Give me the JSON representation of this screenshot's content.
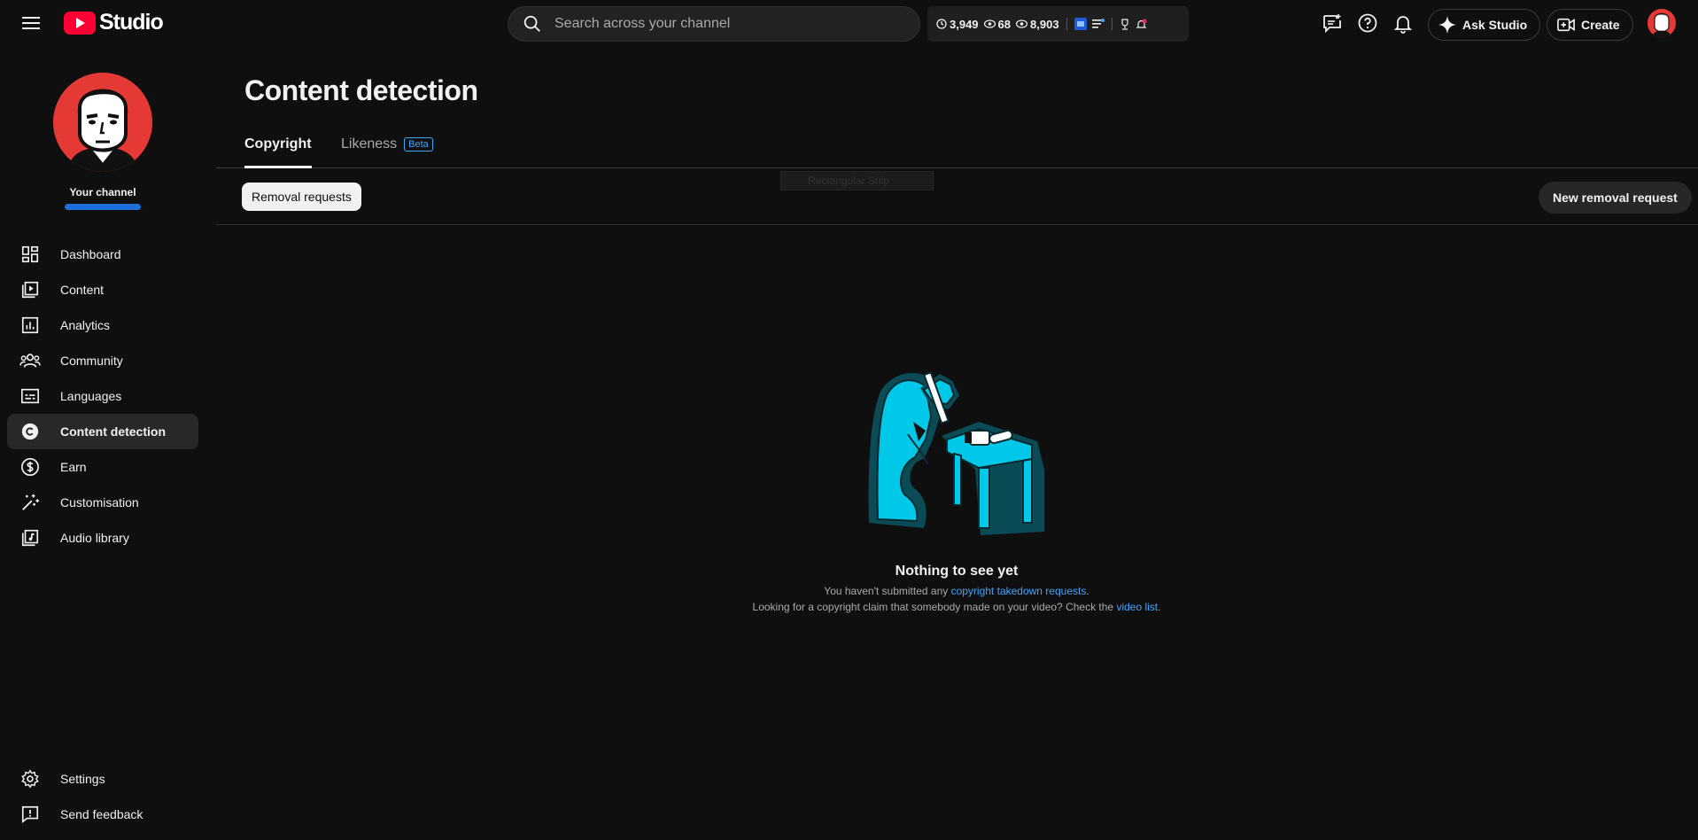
{
  "topbar": {
    "logo_text": "Studio",
    "search_placeholder": "Search across your channel",
    "stats": {
      "watch_hours": "3,949",
      "subscribers": "68",
      "views": "8,903"
    },
    "ask_studio_label": "Ask Studio",
    "create_label": "Create"
  },
  "sidebar": {
    "channel_label": "Your channel",
    "items": [
      {
        "label": "Dashboard",
        "icon": "dashboard-icon"
      },
      {
        "label": "Content",
        "icon": "content-icon"
      },
      {
        "label": "Analytics",
        "icon": "analytics-icon"
      },
      {
        "label": "Community",
        "icon": "community-icon"
      },
      {
        "label": "Languages",
        "icon": "subtitles-icon"
      },
      {
        "label": "Content detection",
        "icon": "copyright-icon",
        "active": true
      },
      {
        "label": "Earn",
        "icon": "dollar-icon"
      },
      {
        "label": "Customisation",
        "icon": "magic-wand-icon"
      },
      {
        "label": "Audio library",
        "icon": "music-library-icon"
      }
    ],
    "bottom_items": [
      {
        "label": "Settings",
        "icon": "gear-icon"
      },
      {
        "label": "Send feedback",
        "icon": "feedback-icon"
      }
    ]
  },
  "main": {
    "title": "Content detection",
    "tabs": [
      {
        "label": "Copyright",
        "active": true
      },
      {
        "label": "Likeness",
        "badge": "Beta"
      }
    ],
    "filter_chip": "Removal requests",
    "new_request_label": "New removal request",
    "ghost_tooltip": "Rectangular Snip",
    "empty": {
      "title": "Nothing to see yet",
      "line1_prefix": "You haven't submitted any ",
      "line1_link": "copyright takedown requests",
      "line1_suffix": ".",
      "line2_prefix": "Looking for a copyright claim that somebody made on your video? Check the ",
      "line2_link": "video list",
      "line2_suffix": "."
    }
  },
  "colors": {
    "accent_link": "#3ea6ff",
    "brand_red": "#ff0033",
    "illustration_cyan": "#00c8e8",
    "illustration_outline": "#0b4b55"
  }
}
